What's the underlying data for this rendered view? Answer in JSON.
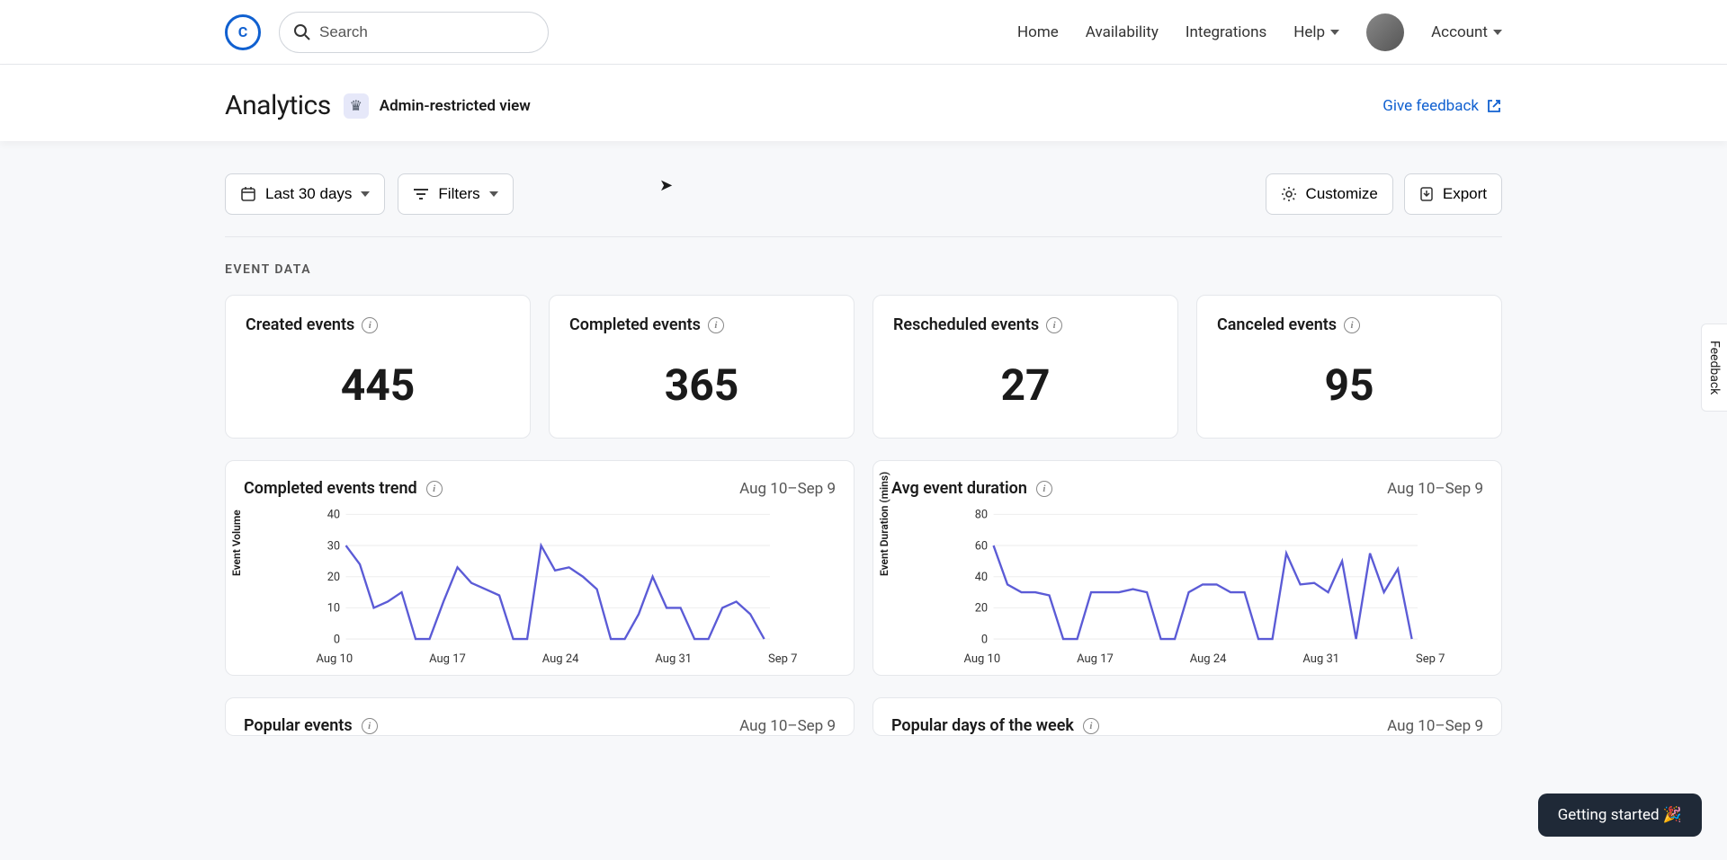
{
  "header": {
    "search_placeholder": "Search",
    "nav": {
      "home": "Home",
      "availability": "Availability",
      "integrations": "Integrations",
      "help": "Help",
      "account": "Account"
    }
  },
  "page": {
    "title": "Analytics",
    "subtitle": "Admin-restricted view",
    "feedback": "Give feedback"
  },
  "toolbar": {
    "date_range": "Last 30 days",
    "filters": "Filters",
    "customize": "Customize",
    "export": "Export"
  },
  "section_label": "EVENT DATA",
  "stats": [
    {
      "label": "Created events",
      "value": "445"
    },
    {
      "label": "Completed events",
      "value": "365"
    },
    {
      "label": "Rescheduled events",
      "value": "27"
    },
    {
      "label": "Canceled events",
      "value": "95"
    }
  ],
  "charts": [
    {
      "title": "Completed events trend",
      "range": "Aug 10–Sep 9",
      "ylabel": "Event Volume"
    },
    {
      "title": "Avg event duration",
      "range": "Aug 10–Sep 9",
      "ylabel": "Event Duration (mins)"
    },
    {
      "title": "Popular events",
      "range": "Aug 10–Sep 9",
      "ylabel": ""
    },
    {
      "title": "Popular days of the week",
      "range": "Aug 10–Sep 9",
      "ylabel": ""
    }
  ],
  "float": {
    "getting_started": "Getting started 🎉",
    "feedback_tab": "Feedback"
  },
  "chart_data": [
    {
      "type": "line",
      "title": "Completed events trend",
      "xlabel": "",
      "ylabel": "Event Volume",
      "ylim": [
        0,
        40
      ],
      "yticks": [
        0,
        10,
        20,
        30,
        40
      ],
      "xticks": [
        "Aug 10",
        "Aug 17",
        "Aug 24",
        "Aug 31",
        "Sep 7"
      ],
      "x": [
        "Aug 10",
        "Aug 11",
        "Aug 12",
        "Aug 13",
        "Aug 14",
        "Aug 15",
        "Aug 16",
        "Aug 17",
        "Aug 18",
        "Aug 19",
        "Aug 20",
        "Aug 21",
        "Aug 22",
        "Aug 23",
        "Aug 24",
        "Aug 25",
        "Aug 26",
        "Aug 27",
        "Aug 28",
        "Aug 29",
        "Aug 30",
        "Aug 31",
        "Sep 1",
        "Sep 2",
        "Sep 3",
        "Sep 4",
        "Sep 5",
        "Sep 6",
        "Sep 7",
        "Sep 8",
        "Sep 9"
      ],
      "values": [
        30,
        24,
        10,
        12,
        15,
        0,
        0,
        12,
        23,
        18,
        16,
        14,
        0,
        0,
        30,
        22,
        23,
        20,
        16,
        0,
        0,
        8,
        20,
        10,
        10,
        0,
        0,
        10,
        12,
        8,
        0
      ]
    },
    {
      "type": "line",
      "title": "Avg event duration",
      "xlabel": "",
      "ylabel": "Event Duration (mins)",
      "ylim": [
        0,
        80
      ],
      "yticks": [
        0,
        20,
        40,
        60,
        80
      ],
      "xticks": [
        "Aug 10",
        "Aug 17",
        "Aug 24",
        "Aug 31",
        "Sep 7"
      ],
      "x": [
        "Aug 10",
        "Aug 11",
        "Aug 12",
        "Aug 13",
        "Aug 14",
        "Aug 15",
        "Aug 16",
        "Aug 17",
        "Aug 18",
        "Aug 19",
        "Aug 20",
        "Aug 21",
        "Aug 22",
        "Aug 23",
        "Aug 24",
        "Aug 25",
        "Aug 26",
        "Aug 27",
        "Aug 28",
        "Aug 29",
        "Aug 30",
        "Aug 31",
        "Sep 1",
        "Sep 2",
        "Sep 3",
        "Sep 4",
        "Sep 5",
        "Sep 6",
        "Sep 7",
        "Sep 8",
        "Sep 9"
      ],
      "values": [
        60,
        35,
        30,
        30,
        28,
        0,
        0,
        30,
        30,
        30,
        32,
        30,
        0,
        0,
        30,
        35,
        35,
        30,
        30,
        0,
        0,
        55,
        35,
        36,
        30,
        50,
        0,
        55,
        30,
        45,
        0
      ]
    }
  ]
}
